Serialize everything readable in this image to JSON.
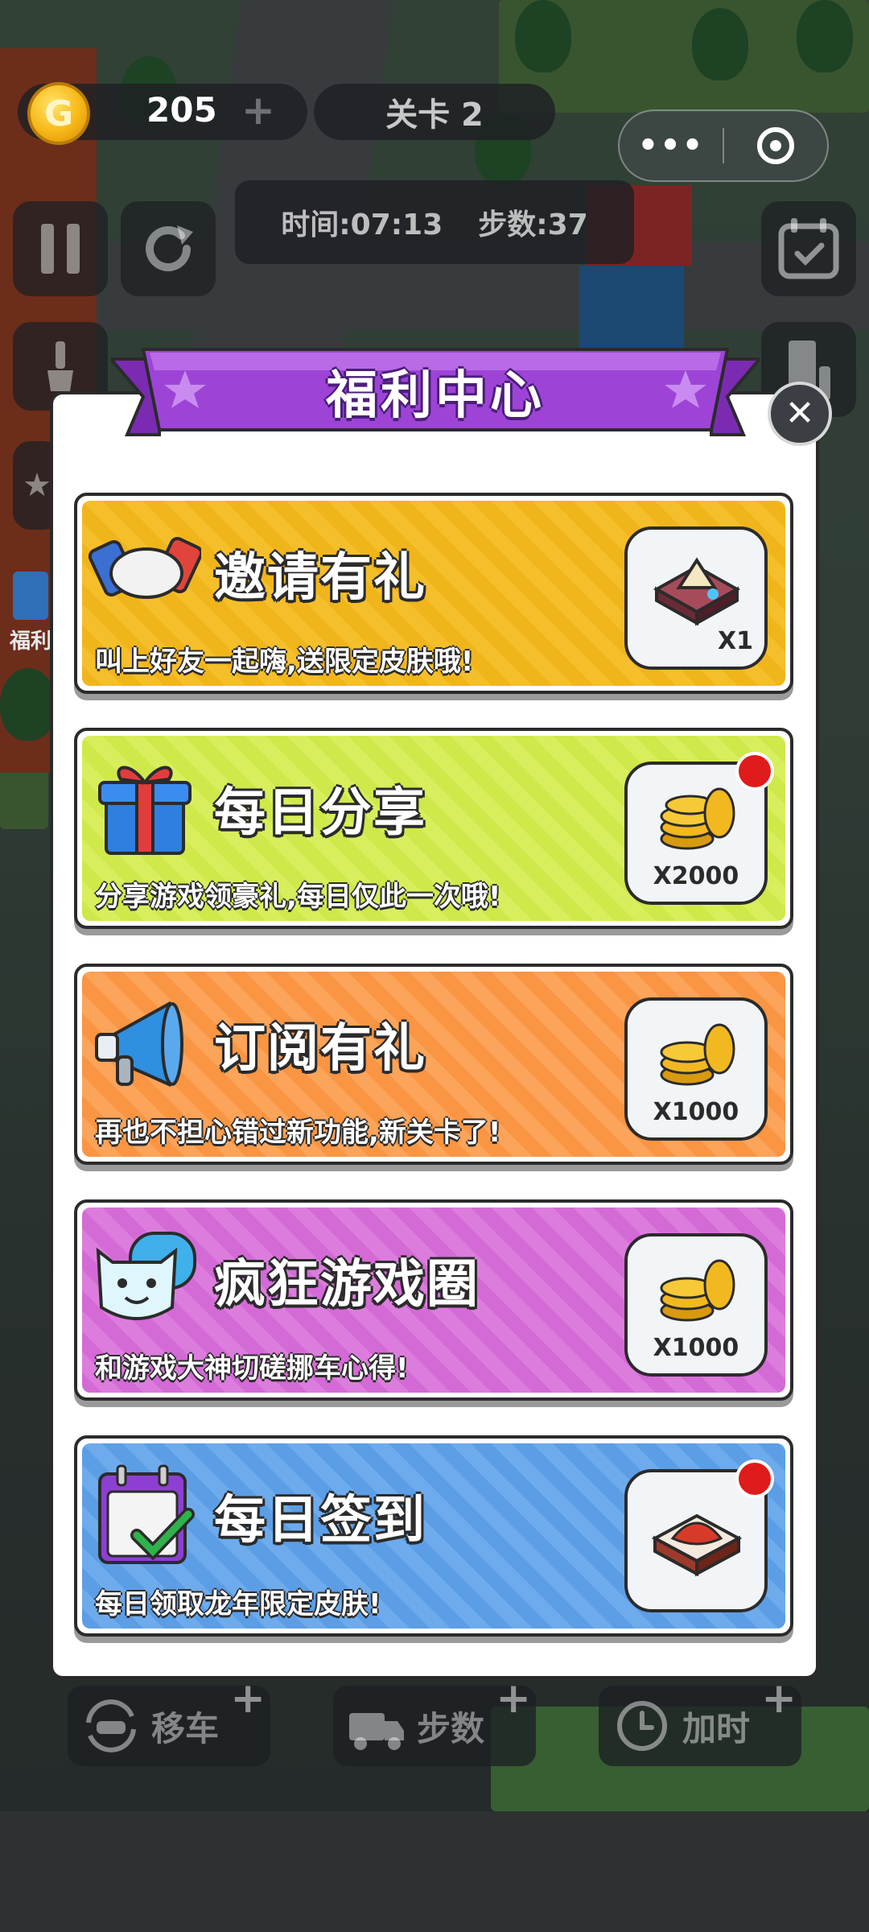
{
  "hud": {
    "coins": "205",
    "coin_symbol": "G",
    "coin_add": "+",
    "level": "关卡 2",
    "time": "时间:07:13",
    "steps": "步数:37",
    "menu_dots": "•••"
  },
  "side_label": "福利",
  "modal": {
    "title": "福利中心",
    "close_symbol": "✕",
    "cards": [
      {
        "title": "邀请有礼",
        "desc": "叫上好友一起嗨,送限定皮肤哦!",
        "reward": "X1",
        "badge": false,
        "theme": "#f3b81f"
      },
      {
        "title": "每日分享",
        "desc": "分享游戏领豪礼,每日仅此一次哦!",
        "reward": "X2000",
        "badge": true,
        "theme": "#d2e94a"
      },
      {
        "title": "订阅有礼",
        "desc": "再也不担心错过新功能,新关卡了!",
        "reward": "X1000",
        "badge": false,
        "theme": "#fa9a4b"
      },
      {
        "title": "疯狂游戏圈",
        "desc": "和游戏大神切磋挪车心得!",
        "reward": "X1000",
        "badge": false,
        "theme": "#d66fd8"
      },
      {
        "title": "每日签到",
        "desc": "每日领取龙年限定皮肤!",
        "reward": "",
        "badge": true,
        "theme": "#5a9de6"
      }
    ]
  },
  "bottom": {
    "move_car": "移车",
    "steps": "步数",
    "add_time": "加时",
    "plus": "+"
  },
  "colors": {
    "ribbon": "#9d44d6",
    "star": "#c98bf0",
    "badge": "#e01b1b"
  }
}
